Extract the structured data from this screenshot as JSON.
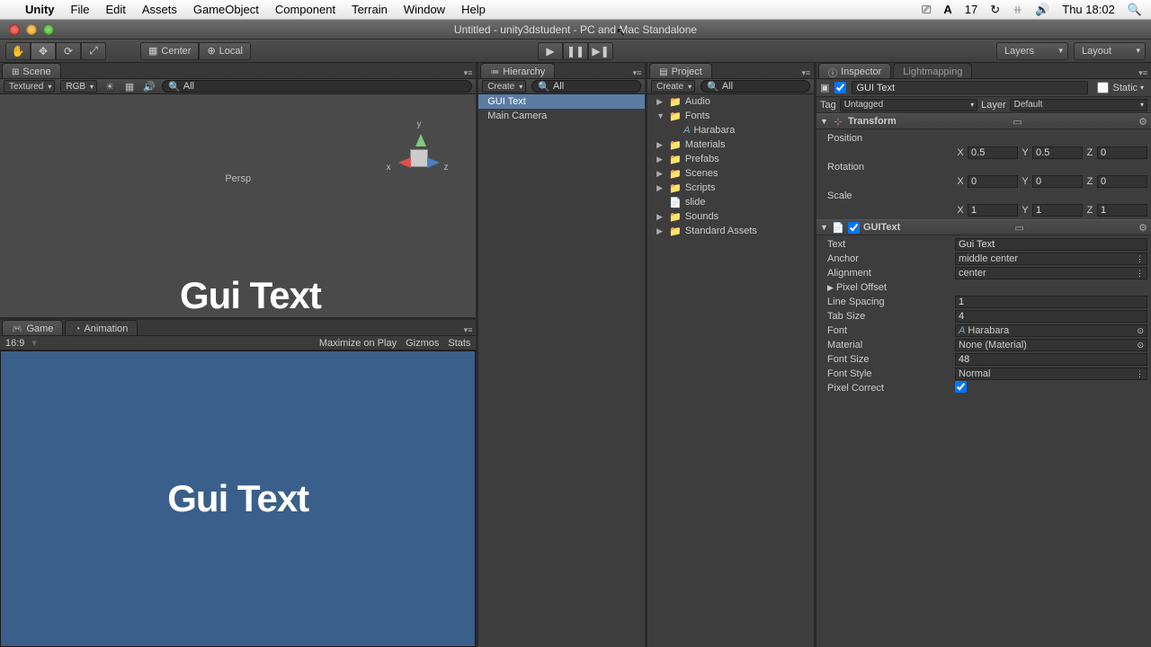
{
  "mac_menu": {
    "app": "Unity",
    "items": [
      "File",
      "Edit",
      "Assets",
      "GameObject",
      "Component",
      "Terrain",
      "Window",
      "Help"
    ],
    "battery": "17",
    "clock": "Thu 18:02"
  },
  "window_title": "Untitled - unity3dstudent - PC and Mac Standalone",
  "toolbar": {
    "center": "Center",
    "local": "Local",
    "layers": "Layers",
    "layout": "Layout"
  },
  "scene": {
    "tab": "Scene",
    "shading": "Textured",
    "render": "RGB",
    "search_placeholder": "All",
    "persp": "Persp",
    "gui_text": "Gui Text",
    "gizmo": {
      "x": "x",
      "y": "y",
      "z": "z"
    }
  },
  "game": {
    "tab": "Game",
    "anim_tab": "Animation",
    "aspect": "16:9",
    "max": "Maximize on Play",
    "gizmos": "Gizmos",
    "stats": "Stats",
    "gui_text": "Gui Text"
  },
  "hierarchy": {
    "tab": "Hierarchy",
    "create": "Create",
    "search_placeholder": "All",
    "items": [
      {
        "name": "GUI Text",
        "selected": true
      },
      {
        "name": "Main Camera",
        "selected": false
      }
    ]
  },
  "project": {
    "tab": "Project",
    "create": "Create",
    "search_placeholder": "All",
    "items": [
      {
        "name": "Audio",
        "type": "folder",
        "indent": 0,
        "expanded": false
      },
      {
        "name": "Fonts",
        "type": "folder",
        "indent": 0,
        "expanded": true
      },
      {
        "name": "Harabara",
        "type": "font",
        "indent": 1
      },
      {
        "name": "Materials",
        "type": "folder",
        "indent": 0,
        "expanded": false
      },
      {
        "name": "Prefabs",
        "type": "folder",
        "indent": 0,
        "expanded": false
      },
      {
        "name": "Scenes",
        "type": "folder",
        "indent": 0,
        "expanded": false
      },
      {
        "name": "Scripts",
        "type": "folder",
        "indent": 0,
        "expanded": false
      },
      {
        "name": "slide",
        "type": "asset",
        "indent": 0
      },
      {
        "name": "Sounds",
        "type": "folder",
        "indent": 0,
        "expanded": false
      },
      {
        "name": "Standard Assets",
        "type": "folder",
        "indent": 0,
        "expanded": false
      }
    ]
  },
  "inspector": {
    "tab": "Inspector",
    "lightmap_tab": "Lightmapping",
    "static": "Static",
    "object": {
      "name": "GUI Text",
      "active": true,
      "static": false
    },
    "tag": {
      "label": "Tag",
      "value": "Untagged"
    },
    "layer": {
      "label": "Layer",
      "value": "Default"
    },
    "transform": {
      "title": "Transform",
      "position": {
        "label": "Position",
        "x": "0.5",
        "y": "0.5",
        "z": "0"
      },
      "rotation": {
        "label": "Rotation",
        "x": "0",
        "y": "0",
        "z": "0"
      },
      "scale": {
        "label": "Scale",
        "x": "1",
        "y": "1",
        "z": "1"
      }
    },
    "guitext": {
      "title": "GUIText",
      "enabled": true,
      "text": {
        "label": "Text",
        "value": "Gui Text"
      },
      "anchor": {
        "label": "Anchor",
        "value": "middle center"
      },
      "alignment": {
        "label": "Alignment",
        "value": "center"
      },
      "pixel_offset": {
        "label": "Pixel Offset"
      },
      "line_spacing": {
        "label": "Line Spacing",
        "value": "1"
      },
      "tab_size": {
        "label": "Tab Size",
        "value": "4"
      },
      "font": {
        "label": "Font",
        "value": "Harabara"
      },
      "material": {
        "label": "Material",
        "value": "None (Material)"
      },
      "font_size": {
        "label": "Font Size",
        "value": "48"
      },
      "font_style": {
        "label": "Font Style",
        "value": "Normal"
      },
      "pixel_correct": {
        "label": "Pixel Correct",
        "value": true
      }
    }
  }
}
